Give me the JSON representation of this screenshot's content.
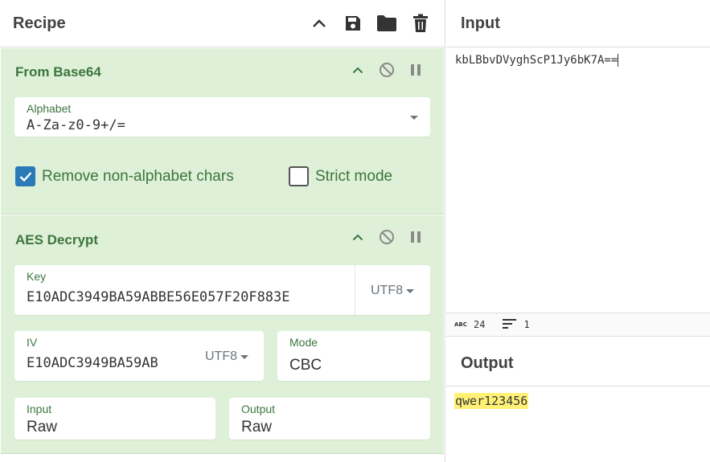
{
  "recipe": {
    "title": "Recipe"
  },
  "operations": {
    "from_base64": {
      "title": "From Base64",
      "alphabet_label": "Alphabet",
      "alphabet_value": "A-Za-z0-9+/=",
      "remove_non_alphabet_label": "Remove non-alphabet chars",
      "remove_non_alphabet_checked": true,
      "strict_mode_label": "Strict mode",
      "strict_mode_checked": false
    },
    "aes_decrypt": {
      "title": "AES Decrypt",
      "key_label": "Key",
      "key_value": "E10ADC3949BA59ABBE56E057F20F883E",
      "key_encoding": "UTF8",
      "iv_label": "IV",
      "iv_value": "E10ADC3949BA59AB",
      "iv_encoding": "UTF8",
      "mode_label": "Mode",
      "mode_value": "CBC",
      "input_label": "Input",
      "input_value": "Raw",
      "output_label": "Output",
      "output_value": "Raw"
    }
  },
  "input": {
    "title": "Input",
    "text": "kbLBbvDVyghScP1Jy6bK7A==",
    "length": "24",
    "lines": "1"
  },
  "output": {
    "title": "Output",
    "text": "qwer123456"
  },
  "colors": {
    "operation_bg": "#dff0d8",
    "operation_text": "#3c763d",
    "checkbox_checked": "#2a7ab8",
    "output_highlight": "#fff176"
  },
  "icons": {
    "recipe_header": [
      "chevron-up-icon",
      "save-icon",
      "folder-icon",
      "trash-icon"
    ],
    "operation_controls": [
      "chevron-up-icon",
      "disable-icon",
      "pause-icon"
    ],
    "status": [
      "abc-length-icon",
      "lines-icon"
    ]
  }
}
